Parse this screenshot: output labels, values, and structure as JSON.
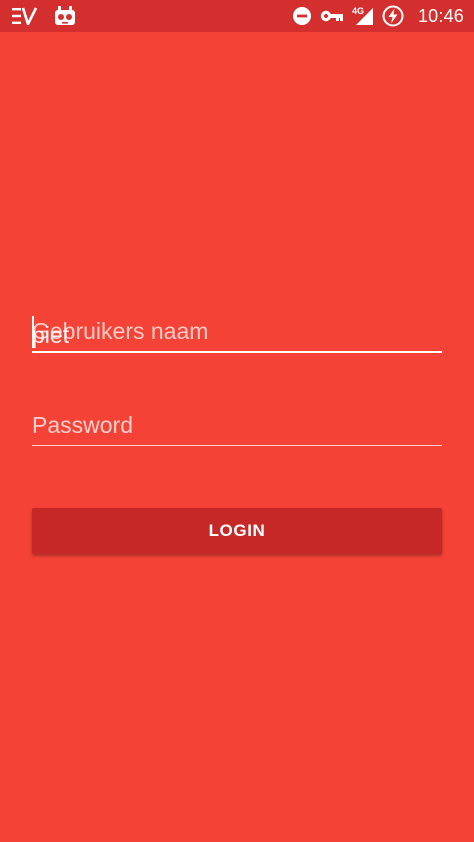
{
  "colors": {
    "background": "#F44336",
    "status_bar": "#D32F2F",
    "button": "#C62828",
    "text": "#FFFFFF"
  },
  "status_bar": {
    "left_icons": [
      "ev-notification-icon",
      "robot-app-icon"
    ],
    "right_icons": [
      "do-not-disturb-icon",
      "vpn-key-icon",
      "signal-4g-icon",
      "battery-charging-icon"
    ],
    "network_label": "4G",
    "time": "10:46"
  },
  "login_form": {
    "username": {
      "value": "piet",
      "placeholder": "Gebruikers naam"
    },
    "password": {
      "value": "",
      "placeholder": "Password"
    },
    "submit_label": "LOGIN"
  }
}
